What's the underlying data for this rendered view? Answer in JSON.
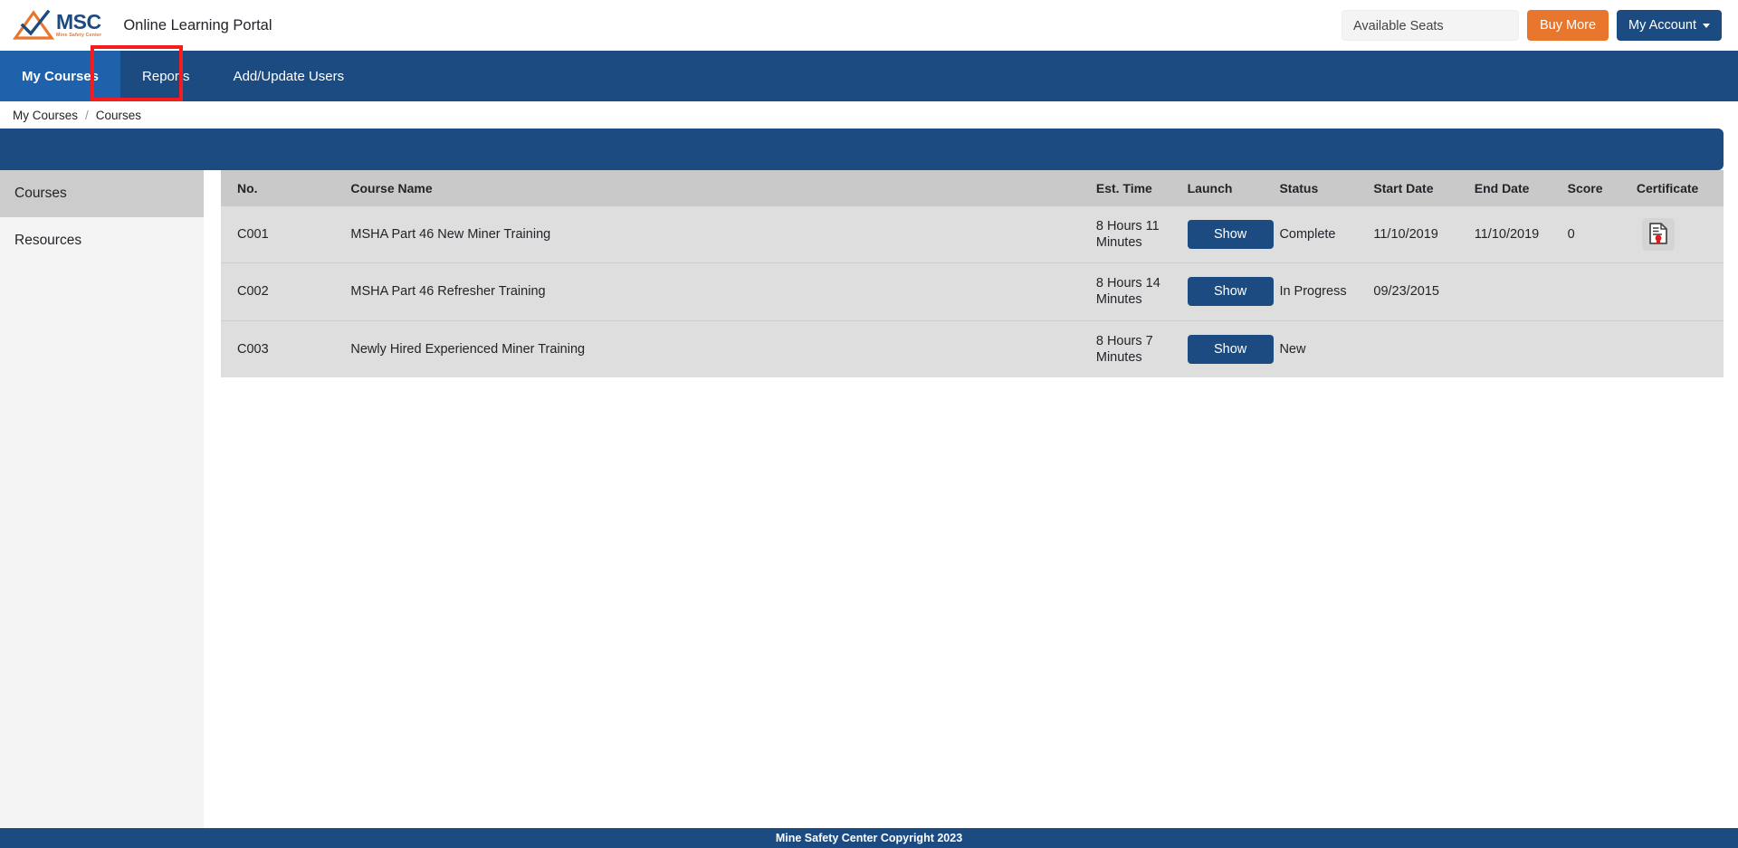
{
  "header": {
    "logo_text": "MSC",
    "logo_subtext": "Mine Safety Center",
    "app_title": "Online Learning Portal",
    "seats_label": "Available Seats",
    "buy_more_label": "Buy More",
    "my_account_label": "My Account"
  },
  "nav": {
    "items": [
      {
        "label": "My Courses",
        "active": true
      },
      {
        "label": "Reports",
        "active": false
      },
      {
        "label": "Add/Update Users",
        "active": false
      }
    ],
    "highlight_target": "Reports",
    "highlight_color": "#f41c1c"
  },
  "breadcrumb": {
    "parent": "My Courses",
    "separator": "/",
    "current": "Courses"
  },
  "sidebar": {
    "items": [
      {
        "label": "Courses",
        "active": true
      },
      {
        "label": "Resources",
        "active": false
      }
    ]
  },
  "table": {
    "headers": [
      "No.",
      "Course Name",
      "Est. Time",
      "Launch",
      "Status",
      "Start Date",
      "End Date",
      "Score",
      "Certificate"
    ],
    "launch_label": "Show",
    "certificate_icon": "certificate-document-icon",
    "rows": [
      {
        "no": "C001",
        "name": "MSHA Part 46 New Miner Training",
        "est_time": "8 Hours 11 Minutes",
        "launch": "Show",
        "status": "Complete",
        "start_date": "11/10/2019",
        "end_date": "11/10/2019",
        "score": "0",
        "certificate": true
      },
      {
        "no": "C002",
        "name": "MSHA Part 46 Refresher Training",
        "est_time": "8 Hours 14 Minutes",
        "launch": "Show",
        "status": "In Progress",
        "start_date": "09/23/2015",
        "end_date": "",
        "score": "",
        "certificate": false
      },
      {
        "no": "C003",
        "name": "Newly Hired Experienced Miner Training",
        "est_time": "8 Hours 7 Minutes",
        "launch": "Show",
        "status": "New",
        "start_date": "",
        "end_date": "",
        "score": "",
        "certificate": false
      }
    ]
  },
  "footer": {
    "text": "Mine Safety Center Copyright 2023"
  },
  "colors": {
    "brand_blue": "#1b4b80",
    "nav_active_blue": "#1f62ab",
    "orange": "#e8762c",
    "table_header_gray": "#c9c9c9",
    "table_row_gray": "#dedede",
    "sidebar_active_gray": "#cccccc",
    "highlight_red": "#f41c1c"
  }
}
